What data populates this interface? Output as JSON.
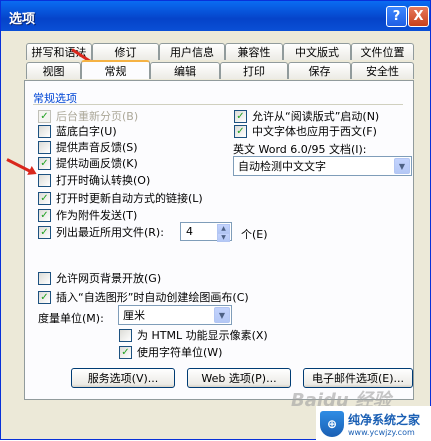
{
  "window": {
    "title": "选项",
    "help_glyph": "?",
    "close_glyph": "X"
  },
  "tabs_back": [
    "拼写和语法",
    "修订",
    "用户信息",
    "兼容性",
    "中文版式",
    "文件位置"
  ],
  "tabs_front": [
    "视图",
    "常规",
    "编辑",
    "打印",
    "保存",
    "安全性"
  ],
  "active_tab": "常规",
  "group_title": "常规选项",
  "left_options": [
    {
      "label": "后台重新分页(B)",
      "checked": true,
      "disabled": true
    },
    {
      "label": "蓝底白字(U)",
      "checked": false,
      "disabled": false
    },
    {
      "label": "提供声音反馈(S)",
      "checked": false,
      "disabled": false
    },
    {
      "label": "提供动画反馈(K)",
      "checked": true,
      "disabled": false
    },
    {
      "label": "打开时确认转换(O)",
      "checked": false,
      "disabled": false
    },
    {
      "label": "打开时更新自动方式的链接(L)",
      "checked": true,
      "disabled": false
    },
    {
      "label": "作为附件发送(T)",
      "checked": true,
      "disabled": false
    },
    {
      "label": "列出最近所用文件(R):",
      "checked": true,
      "disabled": false
    }
  ],
  "recent_files": {
    "value": "4",
    "suffix": "个(E)"
  },
  "right_options": [
    {
      "label": "允许从“阅读版式”启动(N)",
      "checked": true
    },
    {
      "label": "中文字体也应用于西文(F)",
      "checked": true
    }
  ],
  "english_doc": {
    "label": "英文 Word 6.0/95 文档(I):",
    "value": "自动检测中文文字"
  },
  "lower_options": [
    {
      "label": "允许网页背景开放(G)",
      "checked": false
    },
    {
      "label": "插入“自选图形”时自动创建绘图画布(C)",
      "checked": true
    }
  ],
  "measure": {
    "label": "度量单位(M):",
    "value": "厘米"
  },
  "sub_options": [
    {
      "label": "为 HTML 功能显示像素(X)",
      "checked": false
    },
    {
      "label": "使用字符单位(W)",
      "checked": true
    }
  ],
  "buttons": {
    "service": "服务选项(V)...",
    "web": "Web 选项(P)...",
    "email": "电子邮件选项(E)..."
  },
  "watermark": "Baidu 经验",
  "logo": {
    "glyph": "⊕",
    "main": "纯净系统之家",
    "sub": "www.ycwjzy.com"
  },
  "colors": {
    "titlebar": "#0a4fd6",
    "active_tab_accent": "#f5b244",
    "annotation_arrow": "#d9271c",
    "check": "#21a121"
  }
}
